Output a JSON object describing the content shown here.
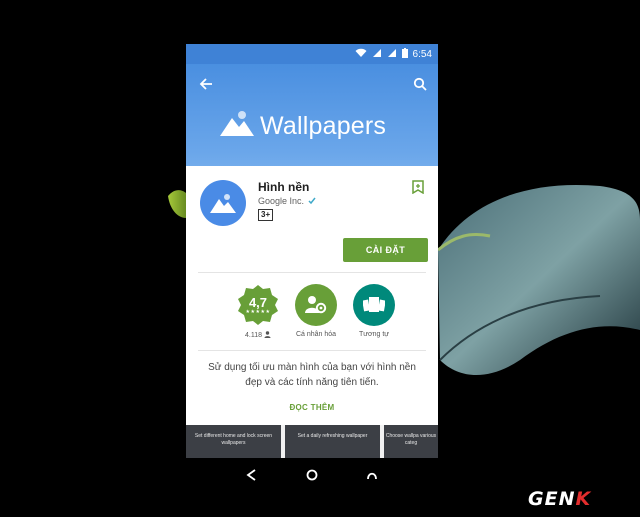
{
  "status_bar": {
    "time": "6:54"
  },
  "hero": {
    "title": "Wallpapers"
  },
  "app": {
    "name": "Hình nền",
    "developer": "Google Inc.",
    "content_rating": "3+",
    "install_label": "CÀI ĐẶT"
  },
  "stats": [
    {
      "value": "4,7",
      "stars": "★★★★★",
      "label": "4.118"
    },
    {
      "label": "Cá nhân hóa"
    },
    {
      "label": "Tương tự"
    }
  ],
  "description": "Sử dụng tối ưu màn hình của bạn với hình nền đẹp và các tính năng tiên tiến.",
  "read_more_label": "ĐỌC THÊM",
  "screenshots": [
    {
      "caption": "Set different home and lock screen wallpapers"
    },
    {
      "caption": "Set a daily refreshing wallpaper"
    },
    {
      "caption": "Choose wallpa various categ"
    }
  ],
  "watermark": {
    "text_main": "GEN",
    "text_accent": "K"
  },
  "colors": {
    "accent_green": "#689f38",
    "hero_blue": "#4a8fe0",
    "teal": "#00897b"
  },
  "icons": [
    "wifi-icon",
    "signal-icon",
    "battery-icon",
    "back-arrow-icon",
    "search-icon",
    "wishlist-icon",
    "verified-icon",
    "user-icon",
    "personalize-icon",
    "similar-apps-icon",
    "nav-back-icon",
    "nav-home-icon",
    "nav-recents-icon"
  ]
}
